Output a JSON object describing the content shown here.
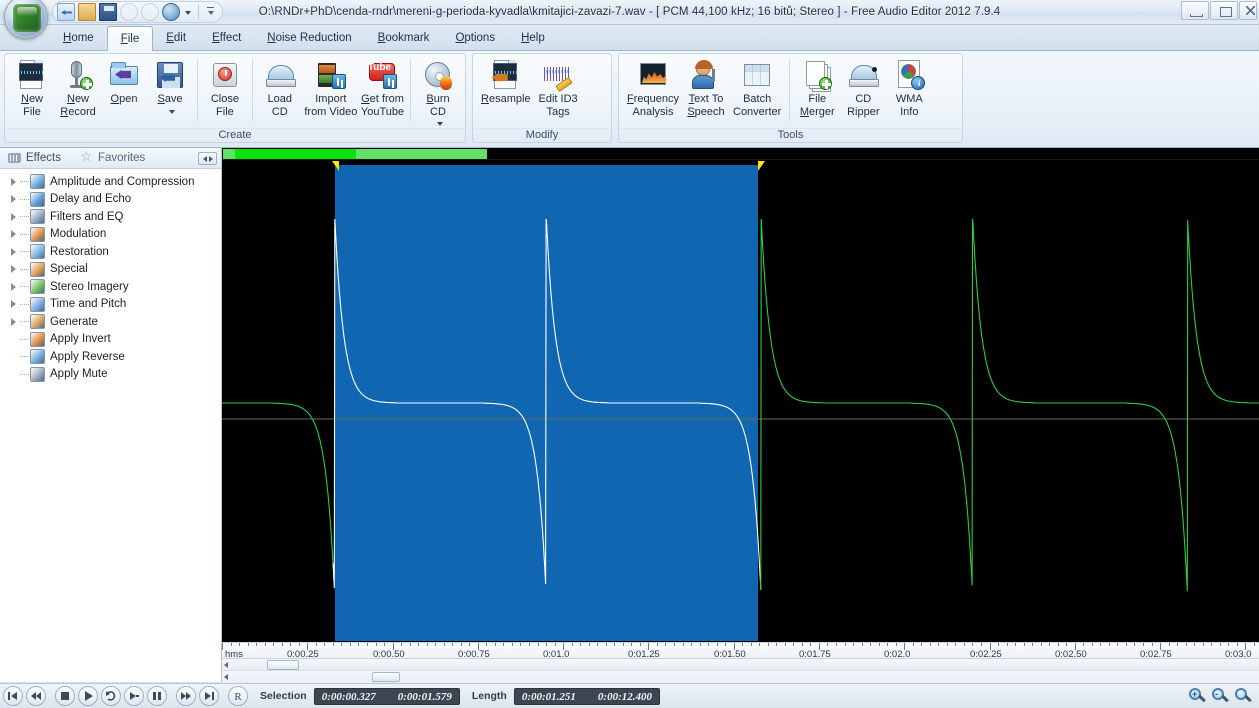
{
  "window": {
    "title": "O:\\RNDr+PhD\\cenda-rndr\\mereni-g-perioda-kyvadla\\kmitajici-zavazi-7.wav - [ PCM 44,100 kHz; 16 bitů; Stereo ] - Free Audio Editor 2012 7.9.4",
    "controls": {
      "minimize": "minimize-icon",
      "maximize": "maximize-icon",
      "close": "close-icon"
    }
  },
  "quick_access": {
    "items": [
      {
        "name": "export-icon"
      },
      {
        "name": "open-icon"
      },
      {
        "name": "save-icon"
      },
      {
        "name": "undo-icon"
      },
      {
        "name": "redo-icon"
      },
      {
        "name": "web-icon"
      }
    ]
  },
  "tabs": [
    {
      "label": "Home",
      "active": false
    },
    {
      "label": "File",
      "active": true
    },
    {
      "label": "Edit",
      "active": false
    },
    {
      "label": "Effect",
      "active": false
    },
    {
      "label": "Noise Reduction",
      "active": false
    },
    {
      "label": "Bookmark",
      "active": false
    },
    {
      "label": "Options",
      "active": false
    },
    {
      "label": "Help",
      "active": false
    }
  ],
  "ribbon": {
    "groups": [
      {
        "label": "Create",
        "buttons": [
          {
            "line1": "New",
            "line2": "File",
            "icon": "new-file-icon",
            "dropdown": false
          },
          {
            "line1": "New",
            "line2": "Record",
            "icon": "new-record-icon",
            "dropdown": false
          },
          {
            "line1": "Open",
            "line2": "",
            "icon": "open-icon",
            "dropdown": false
          },
          {
            "line1": "Save",
            "line2": "",
            "icon": "save-icon",
            "dropdown": true
          },
          {
            "sep": true
          },
          {
            "line1": "Close",
            "line2": "File",
            "icon": "close-file-icon",
            "dropdown": false
          },
          {
            "sep": true
          },
          {
            "line1": "Load",
            "line2": "CD",
            "icon": "load-cd-icon",
            "dropdown": false
          },
          {
            "line1": "Import",
            "line2": "from Video",
            "icon": "import-video-icon",
            "dropdown": false
          },
          {
            "line1": "Get from",
            "line2": "YouTube",
            "icon": "youtube-icon",
            "dropdown": false
          },
          {
            "sep": true
          },
          {
            "line1": "Burn",
            "line2": "CD",
            "icon": "burn-cd-icon",
            "dropdown": true
          }
        ]
      },
      {
        "label": "Modify",
        "buttons": [
          {
            "line1": "Resample",
            "line2": "",
            "icon": "resample-icon",
            "dropdown": false
          },
          {
            "line1": "Edit ID3",
            "line2": "Tags",
            "icon": "edit-id3-icon",
            "dropdown": false
          }
        ]
      },
      {
        "label": "Tools",
        "buttons": [
          {
            "line1": "Frequency",
            "line2": "Analysis",
            "icon": "frequency-analysis-icon",
            "dropdown": false
          },
          {
            "line1": "Text To",
            "line2": "Speech",
            "icon": "text-to-speech-icon",
            "dropdown": false
          },
          {
            "line1": "Batch",
            "line2": "Converter",
            "icon": "batch-converter-icon",
            "dropdown": false
          },
          {
            "sep": true
          },
          {
            "line1": "File",
            "line2": "Merger",
            "icon": "file-merger-icon",
            "dropdown": false
          },
          {
            "line1": "CD",
            "line2": "Ripper",
            "icon": "cd-ripper-icon",
            "dropdown": false
          },
          {
            "line1": "WMA",
            "line2": "Info",
            "icon": "wma-info-icon",
            "dropdown": false
          }
        ]
      }
    ]
  },
  "sidebar": {
    "tabs": [
      {
        "label": "Effects",
        "icon": "equalizer-icon",
        "active": true
      },
      {
        "label": "Favorites",
        "icon": "star-icon",
        "active": false
      }
    ],
    "items": [
      {
        "label": "Amplitude and Compression",
        "expandable": true,
        "icon_color": "#6fa8dc"
      },
      {
        "label": "Delay and Echo",
        "expandable": true,
        "icon_color": "#5b9bd5"
      },
      {
        "label": "Filters and EQ",
        "expandable": true,
        "icon_color": "#8fa9c4"
      },
      {
        "label": "Modulation",
        "expandable": true,
        "icon_color": "#d98e4a"
      },
      {
        "label": "Restoration",
        "expandable": true,
        "icon_color": "#7fb2e0"
      },
      {
        "label": "Special",
        "expandable": true,
        "icon_color": "#e0974a"
      },
      {
        "label": "Stereo Imagery",
        "expandable": true,
        "icon_color": "#6cbf5a"
      },
      {
        "label": "Time and Pitch",
        "expandable": true,
        "icon_color": "#7aa9e0"
      },
      {
        "label": "Generate",
        "expandable": true,
        "icon_color": "#d9a05a"
      },
      {
        "label": "Apply Invert",
        "expandable": false,
        "icon_color": "#e08a3c"
      },
      {
        "label": "Apply Reverse",
        "expandable": false,
        "icon_color": "#6fa8dc"
      },
      {
        "label": "Apply Mute",
        "expandable": false,
        "icon_color": "#9aa9b8"
      }
    ]
  },
  "waveform": {
    "background_color": "#000000",
    "wave_color": "#2ecc40",
    "selection_color": "#1066b0",
    "selected_wave_color": "#ffffff",
    "marker_color": "#ffe800",
    "overview_bar": {
      "light_color": "#63e163",
      "dark_color": "#0ae30a"
    }
  },
  "chart_data": {
    "type": "line",
    "title": "",
    "xlabel": "hms",
    "ylabel": "",
    "xlim": [
      0,
      3.04
    ],
    "ylim": [
      -1,
      1
    ],
    "note": "Audio waveform, pendulum period recording. Sharp bipolar impulse spikes at regular intervals.",
    "spikes_seconds": [
      0.33,
      0.95,
      1.58,
      2.2,
      2.83
    ],
    "selection_seconds": [
      0.327,
      1.579
    ]
  },
  "ruler": {
    "unit_label": "hms",
    "ticks": [
      {
        "label": "0:00.25",
        "seconds": 0.25
      },
      {
        "label": "0:00.50",
        "seconds": 0.5
      },
      {
        "label": "0:00.75",
        "seconds": 0.75
      },
      {
        "label": "0:01.0",
        "seconds": 1.0
      },
      {
        "label": "0:01.25",
        "seconds": 1.25
      },
      {
        "label": "0:01.50",
        "seconds": 1.5
      },
      {
        "label": "0:01.75",
        "seconds": 1.75
      },
      {
        "label": "0:02.0",
        "seconds": 2.0
      },
      {
        "label": "0:02.25",
        "seconds": 2.25
      },
      {
        "label": "0:02.50",
        "seconds": 2.5
      },
      {
        "label": "0:02.75",
        "seconds": 2.75
      },
      {
        "label": "0:03.0",
        "seconds": 3.0
      }
    ]
  },
  "statusbar": {
    "transport": [
      {
        "name": "go-to-start-button",
        "glyph": "skip-back"
      },
      {
        "name": "rewind-button",
        "glyph": "rewind"
      },
      {
        "name": "stop-button",
        "glyph": "stop"
      },
      {
        "name": "play-button",
        "glyph": "play"
      },
      {
        "name": "loop-button",
        "glyph": "loop"
      },
      {
        "name": "play-selection-button",
        "glyph": "play-right"
      },
      {
        "name": "pause-button",
        "glyph": "pause"
      },
      {
        "name": "fast-forward-button",
        "glyph": "forward"
      },
      {
        "name": "go-to-end-button",
        "glyph": "skip-forward"
      },
      {
        "name": "record-button",
        "glyph": "R"
      }
    ],
    "selection_label": "Selection",
    "selection_start": "0:00:00.327",
    "selection_end": "0:00:01.579",
    "length_label": "Length",
    "length_selection": "0:00:01.251",
    "length_total": "0:00:12.400",
    "zoom_buttons": [
      {
        "name": "zoom-in-button",
        "sign": "+"
      },
      {
        "name": "zoom-out-button",
        "sign": "-"
      },
      {
        "name": "zoom-fit-button",
        "sign": ""
      }
    ]
  }
}
